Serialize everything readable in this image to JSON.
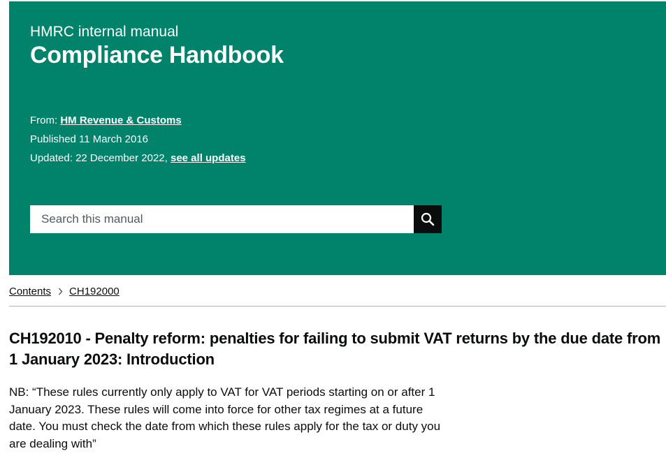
{
  "header": {
    "manual_type": "HMRC internal manual",
    "title": "Compliance Handbook",
    "from_label": "From:",
    "from_link": "HM Revenue & Customs",
    "published": "Published 11 March 2016",
    "updated_label": "Updated:",
    "updated_date": "22 December 2022,",
    "see_all_updates": "see all updates"
  },
  "search": {
    "placeholder": "Search this manual",
    "button_icon": "search-icon"
  },
  "breadcrumb": {
    "items": [
      "Contents",
      "CH192000"
    ],
    "separator_icon": "chevron-right-icon"
  },
  "content": {
    "title": "CH192010 - Penalty reform: penalties for failing to submit VAT returns by the due date from 1 January 2023: Introduction",
    "nb_text": "NB: “These rules currently only apply to VAT for VAT periods starting on or after 1 January 2023. These rules will come into force for other tax regimes at a future date. You must check the date from which these rules apply for the tax or duty you are dealing with”"
  },
  "colors": {
    "header_background": "#00826b",
    "header_text": "#ffffff",
    "search_button": "#0b0c0c",
    "body_text": "#0b0c0c",
    "divider": "#b1b4b6"
  }
}
